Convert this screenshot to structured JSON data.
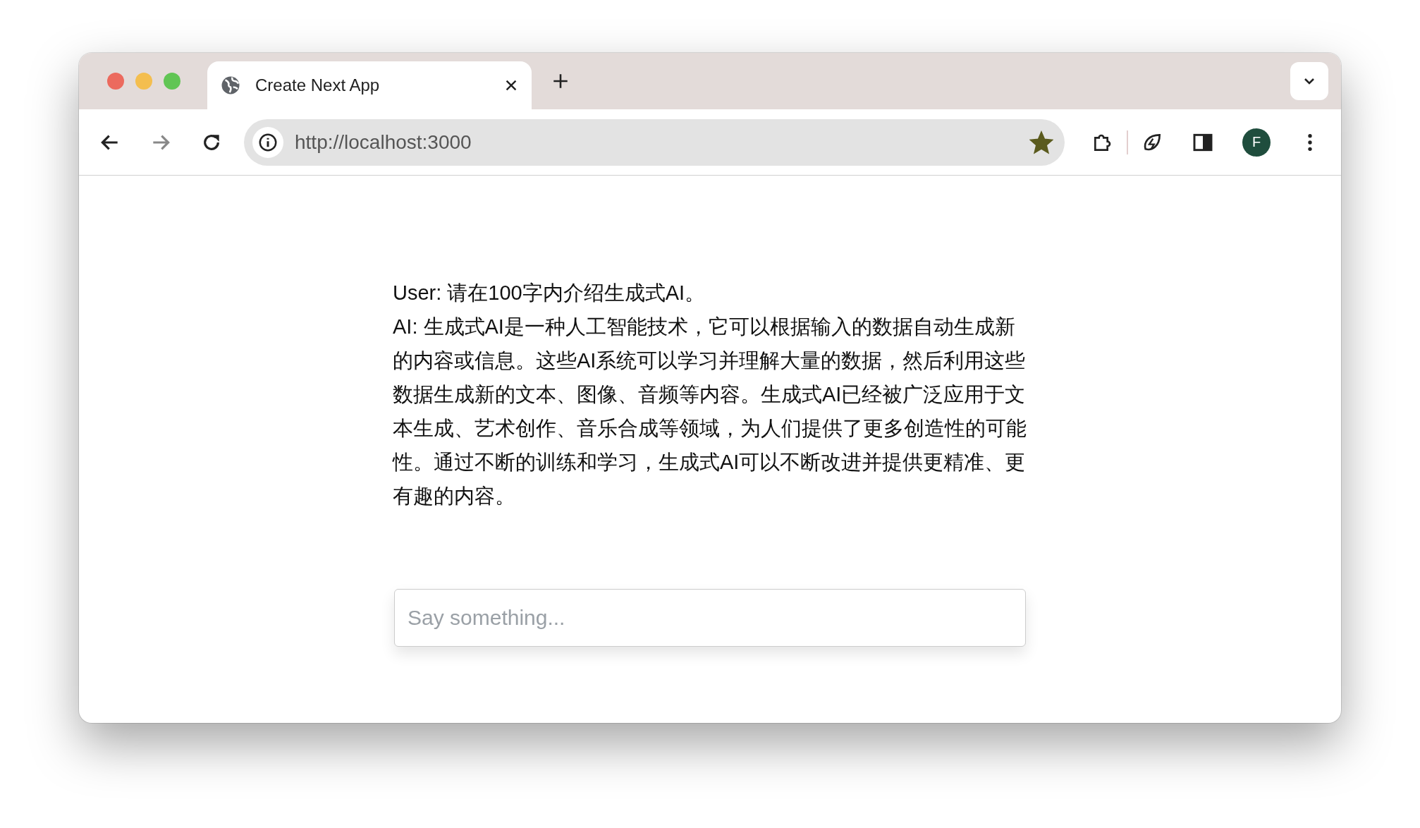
{
  "tab": {
    "title": "Create Next App",
    "selected": true
  },
  "address_bar": {
    "url": "http://localhost:3000",
    "bookmarked": true
  },
  "profile": {
    "initial": "F"
  },
  "messages": [
    {
      "text": "User: 请在100字内介绍生成式AI。"
    },
    {
      "text": "AI: 生成式AI是一种人工智能技术，它可以根据输入的数据自动生成新的内容或信息。这些AI系统可以学习并理解大量的数据，然后利用这些数据生成新的文本、图像、音频等内容。生成式AI已经被广泛应用于文本生成、艺术创作、音乐合成等领域，为人们提供了更多创造性的可能性。通过不断的训练和学习，生成式AI可以不断改进并提供更精准、更有趣的内容。"
    }
  ],
  "input": {
    "placeholder": "Say something..."
  }
}
